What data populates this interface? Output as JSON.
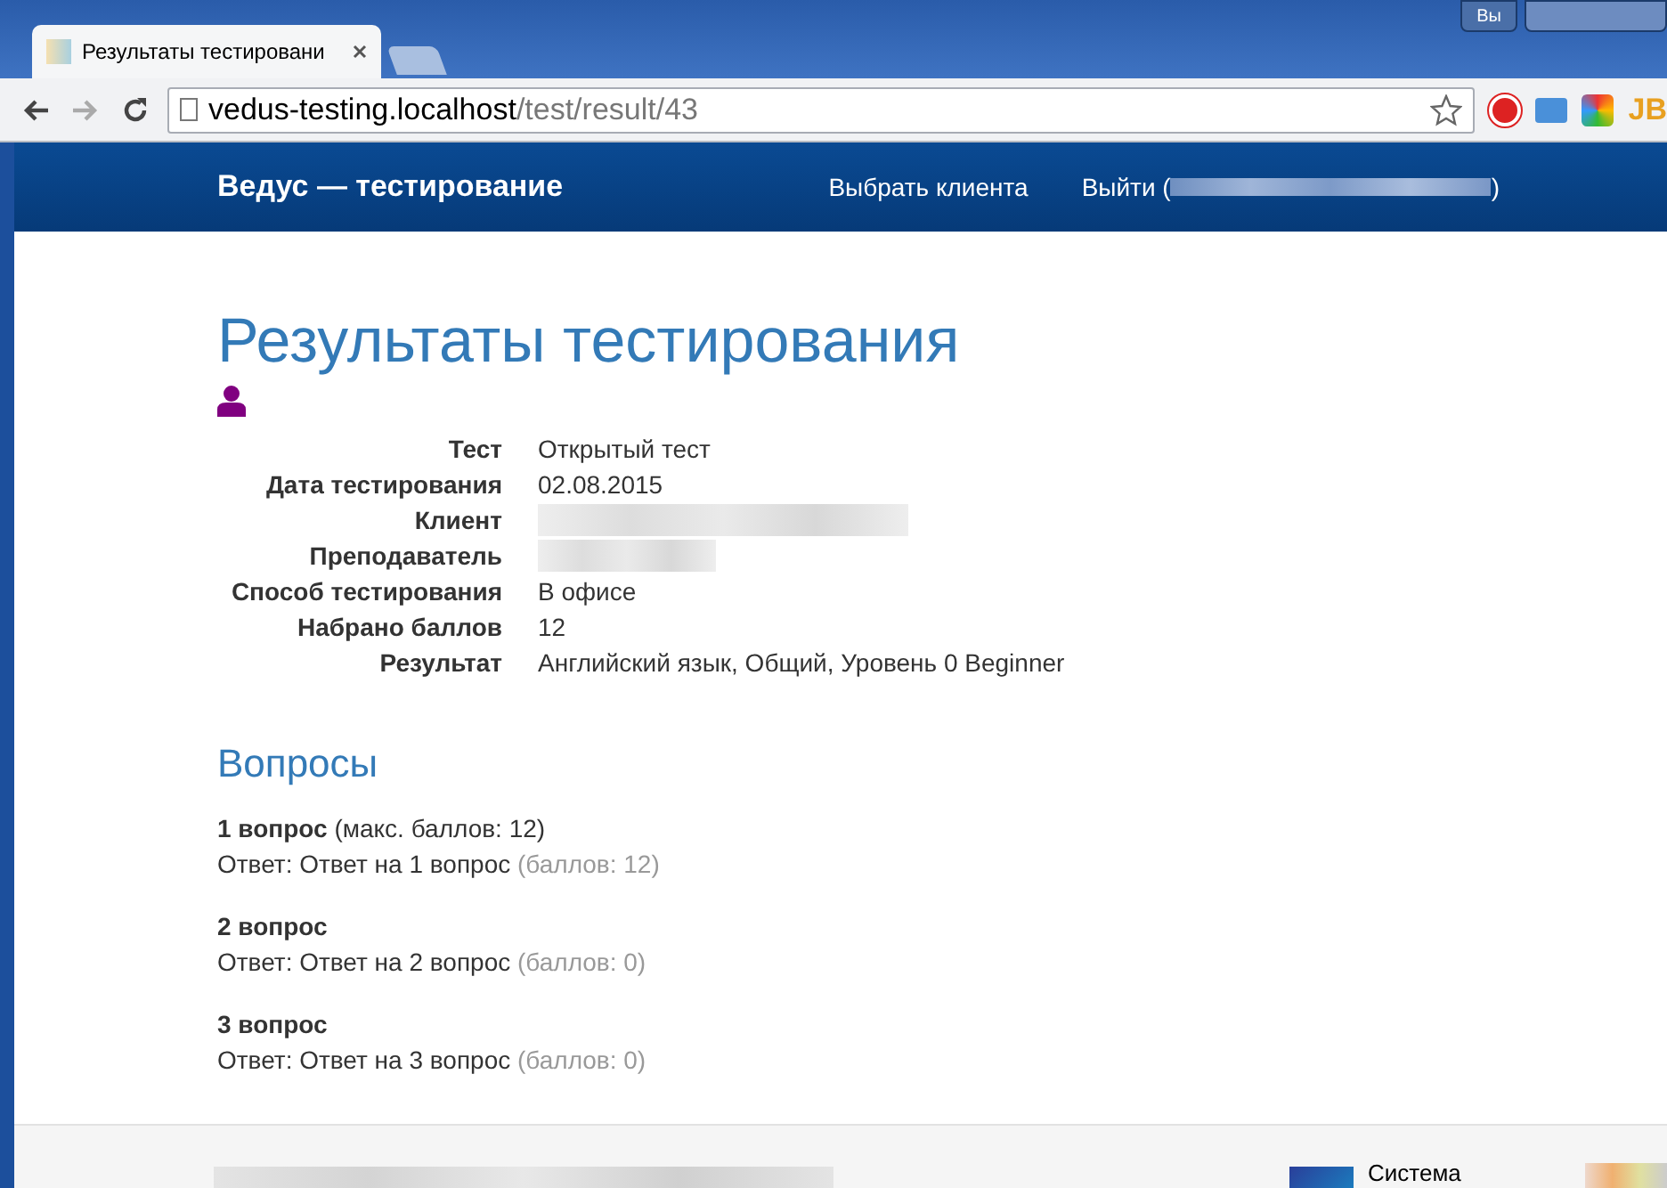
{
  "browser": {
    "tab_title": "Результаты тестировани",
    "profile_button": "Вы",
    "url_host": "vedus-testing.localhost",
    "url_path": "/test/result/43",
    "extension_label": "JB"
  },
  "navbar": {
    "brand": "Ведус — тестирование",
    "links": [
      "Выбрать клиента"
    ],
    "logout_prefix": "Выйти (",
    "logout_suffix": ")"
  },
  "page_title": "Результаты тестирования",
  "details": [
    {
      "label": "Тест",
      "kind": "text",
      "value": "Открытый тест"
    },
    {
      "label": "Дата тестирования",
      "kind": "text",
      "value": "02.08.2015"
    },
    {
      "label": "Клиент",
      "kind": "redacted"
    },
    {
      "label": "Преподаватель",
      "kind": "redacted"
    },
    {
      "label": "Способ тестирования",
      "kind": "text",
      "value": "В офисе"
    },
    {
      "label": "Набрано баллов",
      "kind": "text",
      "value": "12"
    },
    {
      "label": "Результат",
      "kind": "text",
      "value": "Английский язык, Общий, Уровень 0 Beginner"
    }
  ],
  "questions_heading": "Вопросы",
  "questions": [
    {
      "title": "1 вопрос",
      "max_note": "(макс. баллов: 12)",
      "answer": "Ответ: Ответ на 1 вопрос",
      "score": "(баллов: 12)"
    },
    {
      "title": "2 вопрос",
      "answer": "Ответ: Ответ на 2 вопрос",
      "score": "(баллов: 0)"
    },
    {
      "title": "3 вопрос",
      "answer": "Ответ: Ответ на 3 вопрос",
      "score": "(баллов: 0)"
    }
  ],
  "footer": {
    "logo_text": "Система"
  }
}
